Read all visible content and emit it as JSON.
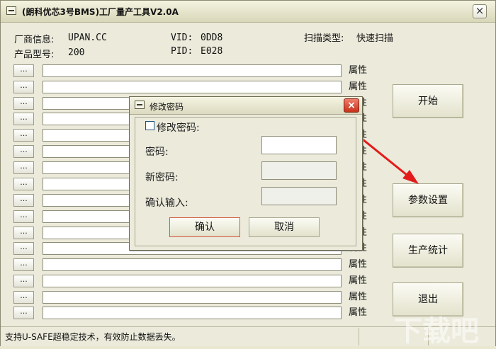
{
  "window": {
    "title": "(朗科优芯3号BMS)工厂量产工具V2.0A",
    "close_label": "×"
  },
  "info": {
    "vendor_label": "厂商信息:",
    "vendor_value": "UPAN.CC",
    "vid_label": "VID:",
    "vid_value": "0DD8",
    "scan_label": "扫描类型:",
    "scan_value": "快速扫描",
    "model_label": "产品型号:",
    "model_value": "200",
    "pid_label": "PID:",
    "pid_value": "E028"
  },
  "rows": {
    "dots_label": "...",
    "attr_label": "属性",
    "count": 16
  },
  "buttons": {
    "start": "开始",
    "settings": "参数设置",
    "stats": "生产统计",
    "exit": "退出"
  },
  "status": {
    "text": "支持U-SAFE超稳定技术，有效防止数据丢失。"
  },
  "dialog": {
    "title": "修改密码",
    "close_label": "×",
    "checkbox_label": "修改密码:",
    "password_label": "密码:",
    "new_password_label": "新密码:",
    "confirm_input_label": "确认输入:",
    "password_value": "",
    "new_password_value": "",
    "confirm_value": "",
    "ok_label": "确认",
    "cancel_label": "取消"
  },
  "watermark": "下载吧"
}
